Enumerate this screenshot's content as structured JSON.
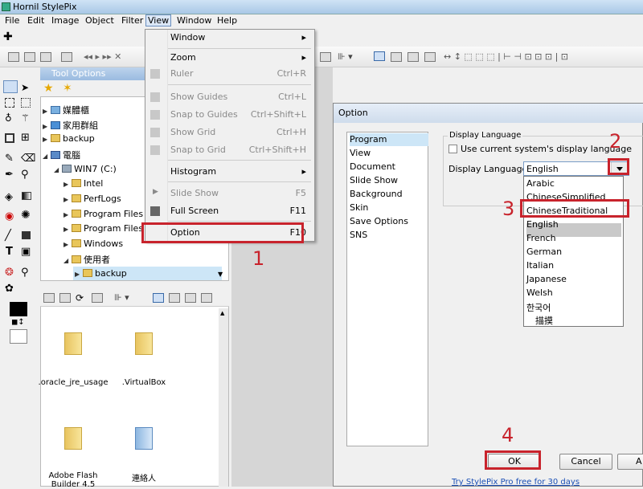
{
  "app": {
    "title": "Hornil StylePix"
  },
  "menubar": {
    "items": [
      "File",
      "Edit",
      "Image",
      "Object",
      "Filter",
      "View",
      "Window",
      "Help"
    ]
  },
  "tool_options": {
    "title": "Tool Options"
  },
  "tree": {
    "items": [
      "媒體櫃",
      "家用群組",
      "backup",
      "電腦",
      "WIN7 (C:)",
      "Intel",
      "PerfLogs",
      "Program Files",
      "Program Files",
      "Windows",
      "使用者",
      "backup"
    ]
  },
  "files": [
    ".oracle_jre_usage",
    ".VirtualBox",
    "Adobe Flash Builder 4.5",
    "連絡人"
  ],
  "view_menu": {
    "items": [
      {
        "label": "Window",
        "shortcut": "",
        "submenu": true,
        "disabled": false
      },
      {
        "label": "Zoom",
        "shortcut": "",
        "submenu": true,
        "disabled": false
      },
      {
        "label": "Ruler",
        "shortcut": "Ctrl+R",
        "submenu": false,
        "disabled": true
      },
      {
        "label": "Show Guides",
        "shortcut": "Ctrl+L",
        "submenu": false,
        "disabled": true
      },
      {
        "label": "Snap to Guides",
        "shortcut": "Ctrl+Shift+L",
        "submenu": false,
        "disabled": true
      },
      {
        "label": "Show Grid",
        "shortcut": "Ctrl+H",
        "submenu": false,
        "disabled": true
      },
      {
        "label": "Snap to Grid",
        "shortcut": "Ctrl+Shift+H",
        "submenu": false,
        "disabled": true
      },
      {
        "label": "Histogram",
        "shortcut": "",
        "submenu": true,
        "disabled": false
      },
      {
        "label": "Slide Show",
        "shortcut": "F5",
        "submenu": false,
        "disabled": true
      },
      {
        "label": "Full Screen",
        "shortcut": "F11",
        "submenu": false,
        "disabled": false
      },
      {
        "label": "Option",
        "shortcut": "F10",
        "submenu": false,
        "disabled": false
      }
    ]
  },
  "dialog": {
    "title": "Option",
    "categories": [
      "Program",
      "View",
      "Document",
      "Slide Show",
      "Background",
      "Skin",
      "Save Options",
      "SNS"
    ],
    "group_label": "Display Language",
    "checkbox_label": "Use current system's display language",
    "combo_label": "Display Language:",
    "combo_value": "English",
    "languages": [
      "Arabic",
      "ChineseSimplified",
      "ChineseTraditional",
      "English",
      "French",
      "German",
      "Italian",
      "Japanese",
      "Welsh",
      "한국어",
      "描摸"
    ],
    "ok": "OK",
    "cancel": "Cancel",
    "apply": "A",
    "link": "Try StylePix Pro free for 30 days"
  },
  "annotations": {
    "step1": "1",
    "step2": "2",
    "step3": "3",
    "step4": "4",
    "color": "#c8232c"
  }
}
